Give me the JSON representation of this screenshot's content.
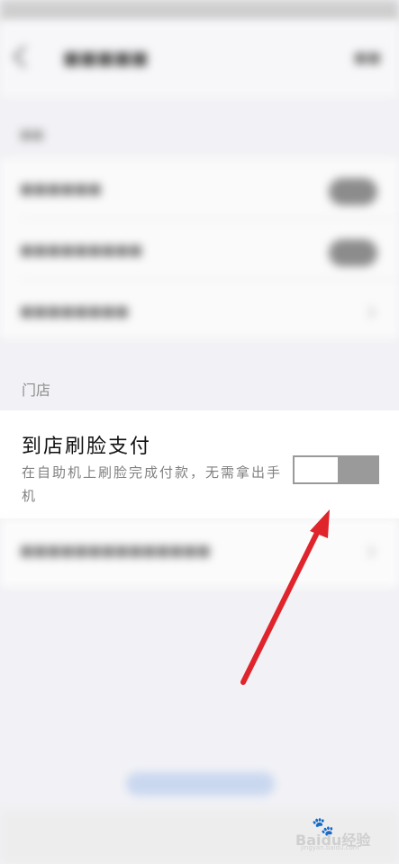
{
  "store_section": {
    "label": "门店"
  },
  "face_pay": {
    "title": "到店刷脸支付",
    "description": "在自助机上刷脸完成付款，无需拿出手机",
    "enabled": false
  },
  "watermark": {
    "brand": "Baidu经验",
    "url": "jingyan.baidu.com"
  },
  "colors": {
    "toggle_off": "#9a9a9a",
    "arrow": "#e0242c",
    "card": "#ffffff",
    "background": "#f2f2f6"
  },
  "icons": [
    "back-arrow-icon",
    "chevron-right-icon",
    "pointer-arrow-icon",
    "baidu-paw-icon"
  ]
}
